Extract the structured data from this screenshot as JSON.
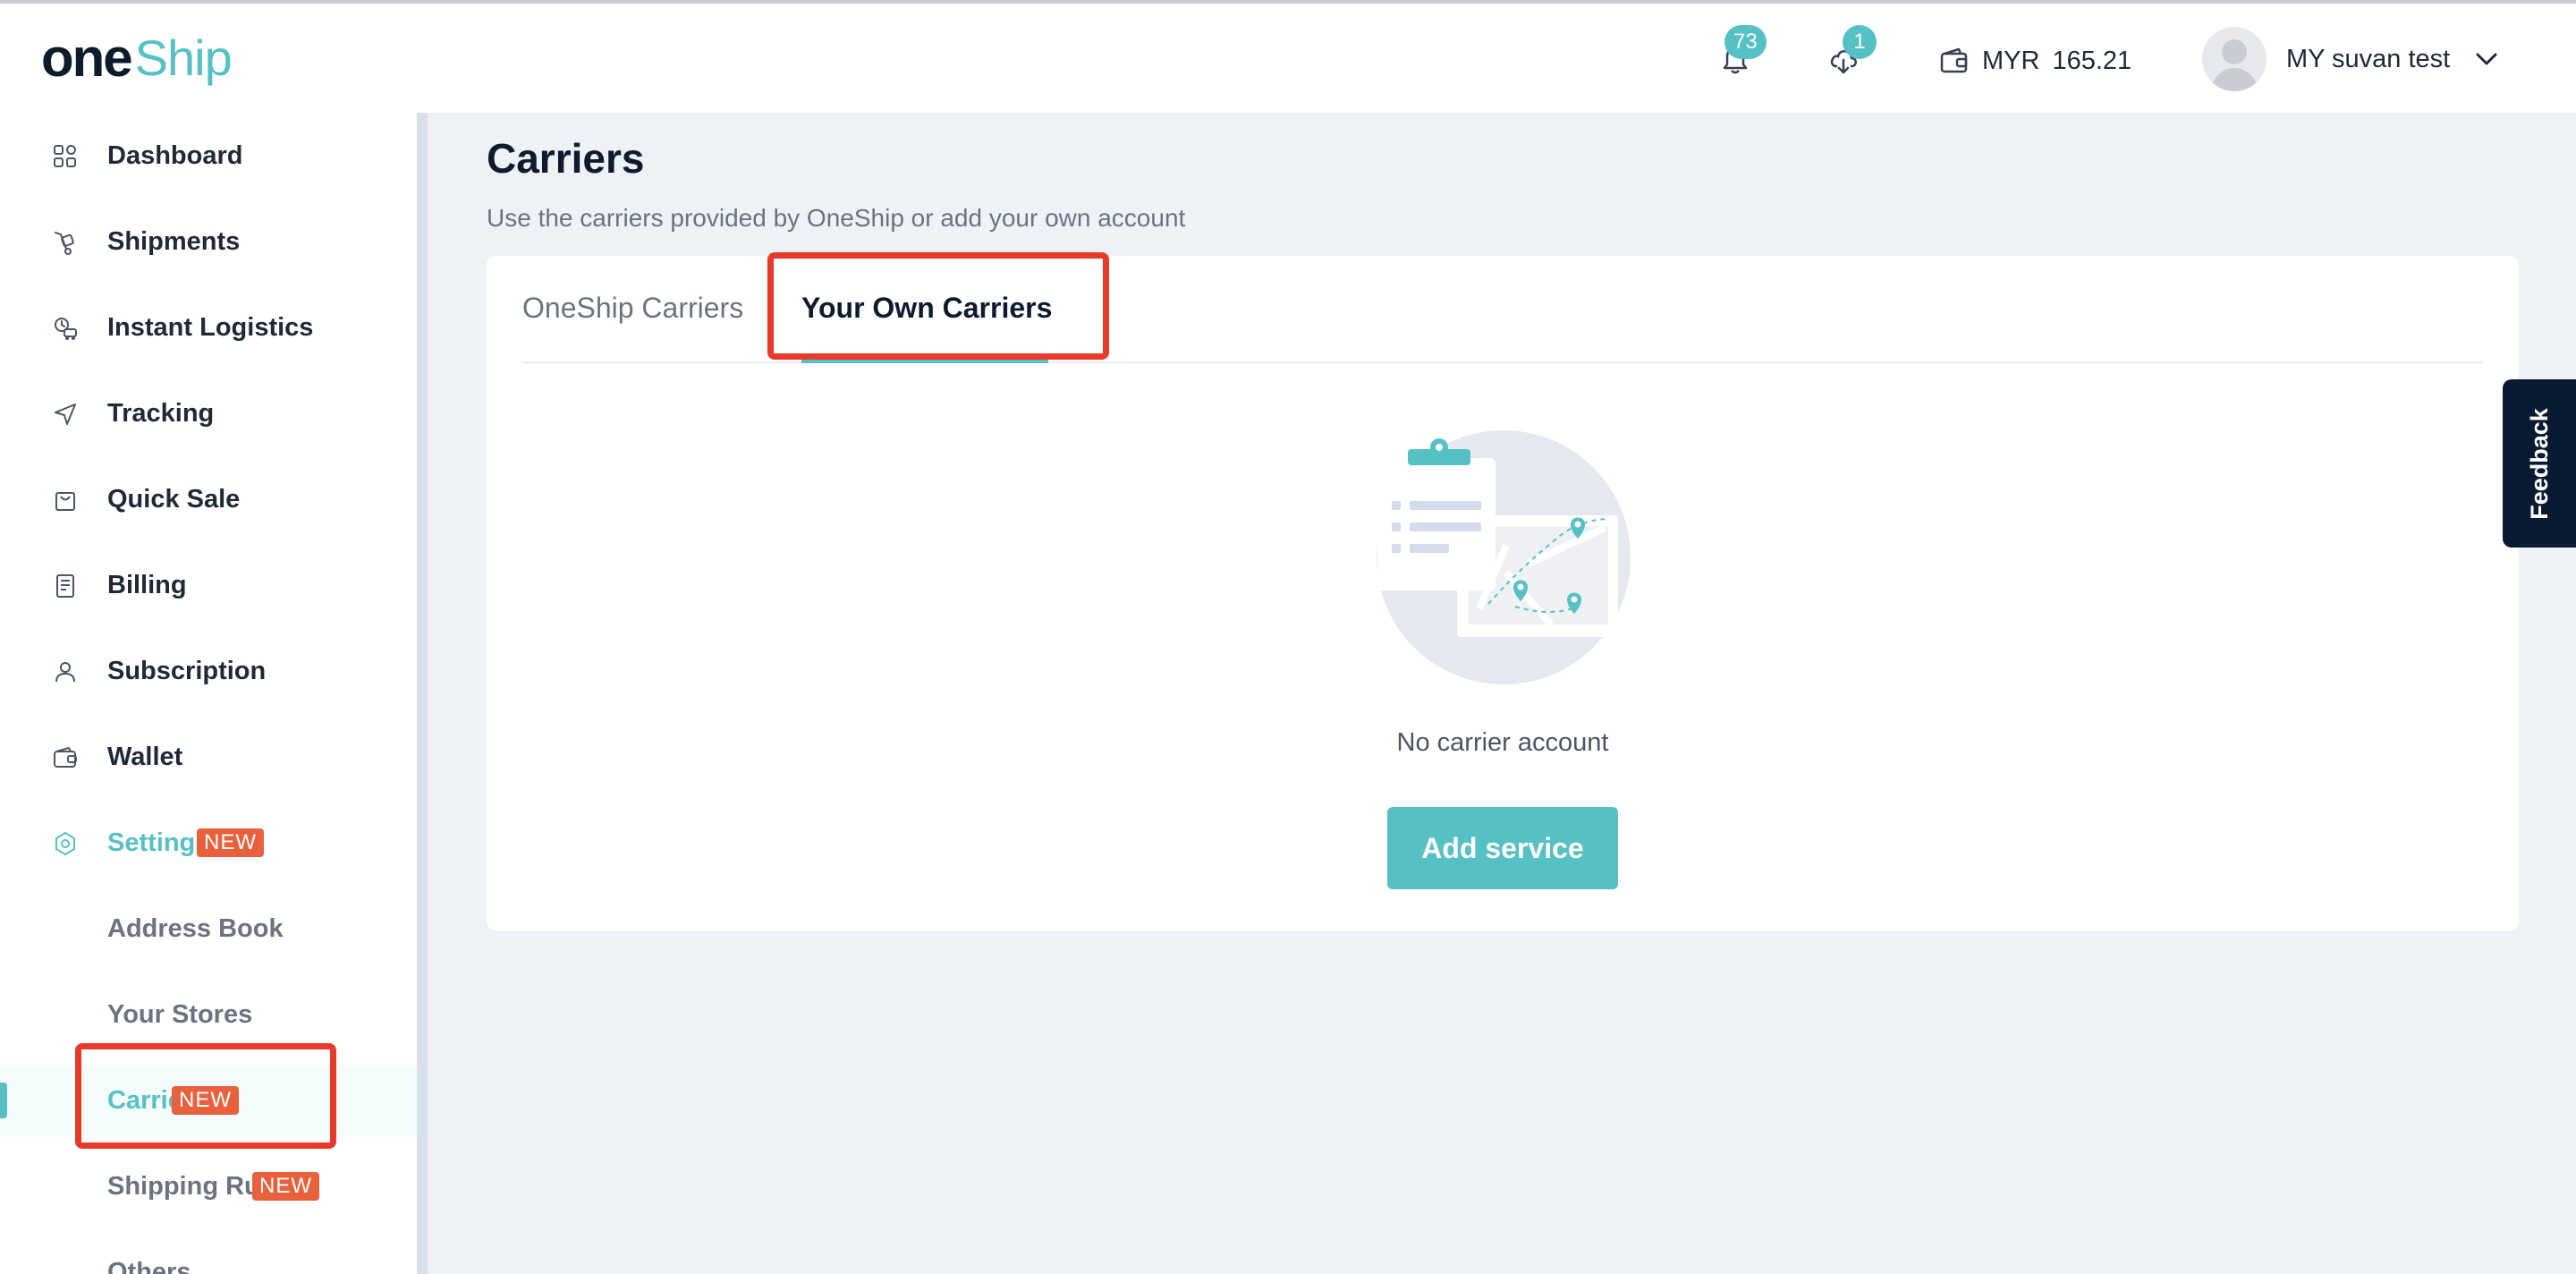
{
  "header": {
    "logo_one": "one",
    "logo_ship": "Ship",
    "notifications_count": "73",
    "downloads_count": "1",
    "wallet_currency": "MYR",
    "wallet_balance": "165.21",
    "user_name": "MY suvan test"
  },
  "sidebar": {
    "items": [
      {
        "label": "Dashboard",
        "icon": "dashboard-icon"
      },
      {
        "label": "Shipments",
        "icon": "shipments-icon"
      },
      {
        "label": "Instant Logistics",
        "icon": "instant-logistics-icon"
      },
      {
        "label": "Tracking",
        "icon": "tracking-icon"
      },
      {
        "label": "Quick Sale",
        "icon": "quick-sale-icon"
      },
      {
        "label": "Billing",
        "icon": "billing-icon"
      },
      {
        "label": "Subscription",
        "icon": "subscription-icon"
      },
      {
        "label": "Wallet",
        "icon": "wallet-icon"
      },
      {
        "label": "Settings",
        "icon": "settings-icon",
        "badge": "NEW"
      }
    ],
    "sub_items": [
      {
        "label": "Address Book"
      },
      {
        "label": "Your Stores"
      },
      {
        "label": "Carriers",
        "badge": "NEW"
      },
      {
        "label": "Shipping Rules",
        "badge": "NEW"
      },
      {
        "label": "Others"
      }
    ]
  },
  "main": {
    "title": "Carriers",
    "subtitle": "Use the carriers provided by OneShip or add your own account",
    "tabs": [
      {
        "label": "OneShip Carriers"
      },
      {
        "label": "Your Own Carriers"
      }
    ],
    "empty_text": "No carrier account",
    "add_button": "Add service"
  },
  "feedback_label": "Feedback",
  "colors": {
    "accent": "#56c1c4",
    "badge": "#e8603c",
    "highlight": "#e83a28",
    "dark": "#0b1a33"
  }
}
